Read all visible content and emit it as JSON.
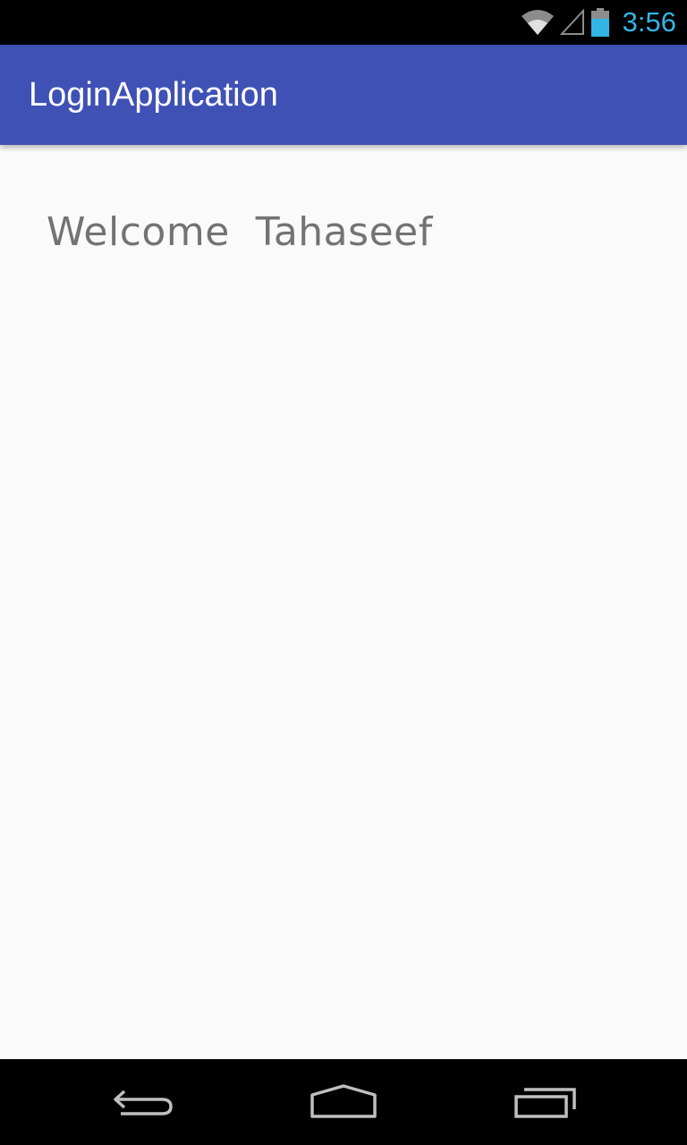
{
  "status_bar": {
    "time": "3:56",
    "icons": [
      "wifi-icon",
      "cell-signal-icon",
      "battery-icon"
    ],
    "time_color": "#33b5e5"
  },
  "app_bar": {
    "title": "LoginApplication",
    "color": "#3f51b5"
  },
  "main": {
    "welcome_text": "Welcome  Tahaseef"
  },
  "nav_bar": {
    "buttons": [
      "back-icon",
      "home-icon",
      "recent-apps-icon"
    ]
  }
}
